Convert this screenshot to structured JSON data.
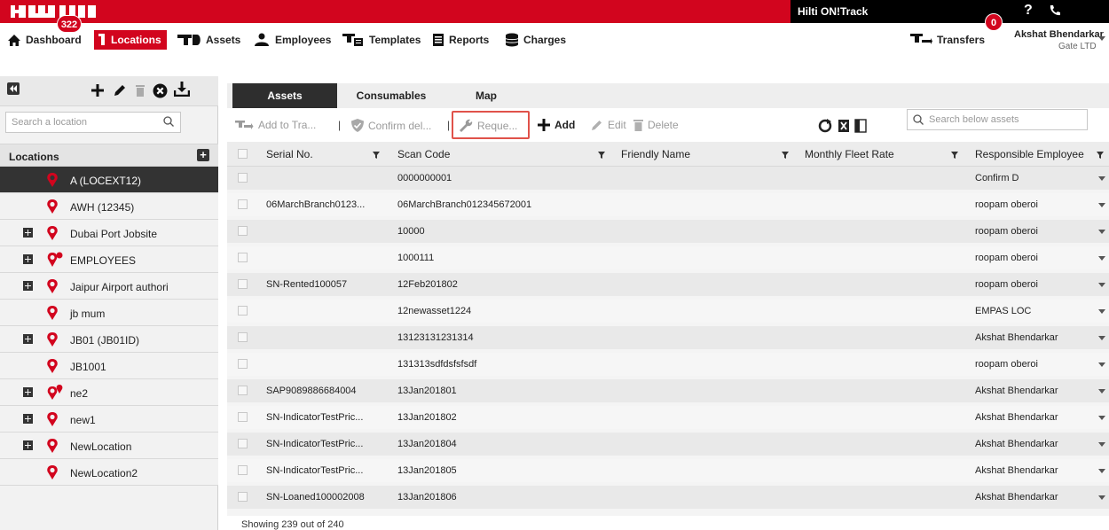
{
  "brand": {
    "logo_text": "HILTI"
  },
  "topbar": {
    "product_name": "Hilti ON!Track",
    "help_label": "?",
    "accent_color": "#d2051e"
  },
  "nav": {
    "dashboard": {
      "label": "Dashboard",
      "badge": "322"
    },
    "locations": {
      "label": "Locations"
    },
    "assets": {
      "label": "Assets"
    },
    "employees": {
      "label": "Employees"
    },
    "templates": {
      "label": "Templates"
    },
    "reports": {
      "label": "Reports"
    },
    "charges": {
      "label": "Charges"
    },
    "transfers": {
      "label": "Transfers",
      "badge": "0"
    },
    "user": {
      "name": "Akshat Bhendarkar",
      "company": "Gate LTD"
    }
  },
  "sidebar": {
    "search_placeholder": "Search a location",
    "header": "Locations",
    "items": [
      {
        "label": "A (LOCEXT12)",
        "expandable": false,
        "selected": true,
        "icon": "location-pin-icon"
      },
      {
        "label": "AWH (12345)",
        "expandable": false,
        "selected": false,
        "icon": "location-pin-icon"
      },
      {
        "label": "Dubai Port Jobsite",
        "expandable": true,
        "selected": false,
        "icon": "location-pin-icon"
      },
      {
        "label": "EMPLOYEES",
        "expandable": true,
        "selected": false,
        "icon": "employee-pin-icon"
      },
      {
        "label": "Jaipur Airport authori",
        "expandable": true,
        "selected": false,
        "icon": "location-pin-icon"
      },
      {
        "label": "jb mum",
        "expandable": false,
        "selected": false,
        "icon": "location-pin-icon"
      },
      {
        "label": "JB01 (JB01ID)",
        "expandable": true,
        "selected": false,
        "icon": "location-pin-icon"
      },
      {
        "label": "JB1001",
        "expandable": false,
        "selected": false,
        "icon": "location-pin-icon"
      },
      {
        "label": "ne2",
        "expandable": true,
        "selected": false,
        "icon": "multi-pin-icon"
      },
      {
        "label": "new1",
        "expandable": true,
        "selected": false,
        "icon": "location-pin-icon"
      },
      {
        "label": "NewLocation",
        "expandable": true,
        "selected": false,
        "icon": "location-pin-icon"
      },
      {
        "label": "NewLocation2",
        "expandable": false,
        "selected": false,
        "icon": "location-pin-icon"
      }
    ]
  },
  "tabs": [
    {
      "label": "Assets",
      "active": true
    },
    {
      "label": "Consumables",
      "active": false
    },
    {
      "label": "Map",
      "active": false
    }
  ],
  "actions": {
    "add_to_transfer": "Add to Tra...",
    "confirm_delivery": "Confirm del...",
    "request": "Reque...",
    "add": "Add",
    "edit": "Edit",
    "delete": "Delete",
    "separator": "|"
  },
  "asset_search_placeholder": "Search below assets",
  "table": {
    "columns": [
      "Serial No.",
      "Scan Code",
      "Friendly Name",
      "Monthly Fleet Rate",
      "Responsible Employee"
    ],
    "rows": [
      {
        "serial": "",
        "scan": "0000000001",
        "friendly": "",
        "rate": "",
        "employee": "Confirm D"
      },
      {
        "serial": "06MarchBranch0123...",
        "scan": "06MarchBranch012345672001",
        "friendly": "",
        "rate": "",
        "employee": "roopam oberoi"
      },
      {
        "serial": "",
        "scan": "10000",
        "friendly": "",
        "rate": "",
        "employee": "roopam oberoi"
      },
      {
        "serial": "",
        "scan": "1000111",
        "friendly": "",
        "rate": "",
        "employee": "roopam oberoi"
      },
      {
        "serial": "SN-Rented100057",
        "scan": "12Feb201802",
        "friendly": "",
        "rate": "",
        "employee": "roopam oberoi"
      },
      {
        "serial": "",
        "scan": "12newasset1224",
        "friendly": "",
        "rate": "",
        "employee": "EMPAS LOC"
      },
      {
        "serial": "",
        "scan": "13123131231314",
        "friendly": "",
        "rate": "",
        "employee": "Akshat Bhendarkar"
      },
      {
        "serial": "",
        "scan": "131313sdfdsfsfsdf",
        "friendly": "",
        "rate": "",
        "employee": "roopam oberoi"
      },
      {
        "serial": "SAP9089886684004",
        "scan": "13Jan201801",
        "friendly": "",
        "rate": "",
        "employee": "Akshat Bhendarkar"
      },
      {
        "serial": "SN-IndicatorTestPric...",
        "scan": "13Jan201802",
        "friendly": "",
        "rate": "",
        "employee": "Akshat Bhendarkar"
      },
      {
        "serial": "SN-IndicatorTestPric...",
        "scan": "13Jan201804",
        "friendly": "",
        "rate": "",
        "employee": "Akshat Bhendarkar"
      },
      {
        "serial": "SN-IndicatorTestPric...",
        "scan": "13Jan201805",
        "friendly": "",
        "rate": "",
        "employee": "Akshat Bhendarkar"
      },
      {
        "serial": "SN-Loaned100002008",
        "scan": "13Jan201806",
        "friendly": "",
        "rate": "",
        "employee": "Akshat Bhendarkar"
      }
    ],
    "footer": "Showing 239 out of 240"
  }
}
